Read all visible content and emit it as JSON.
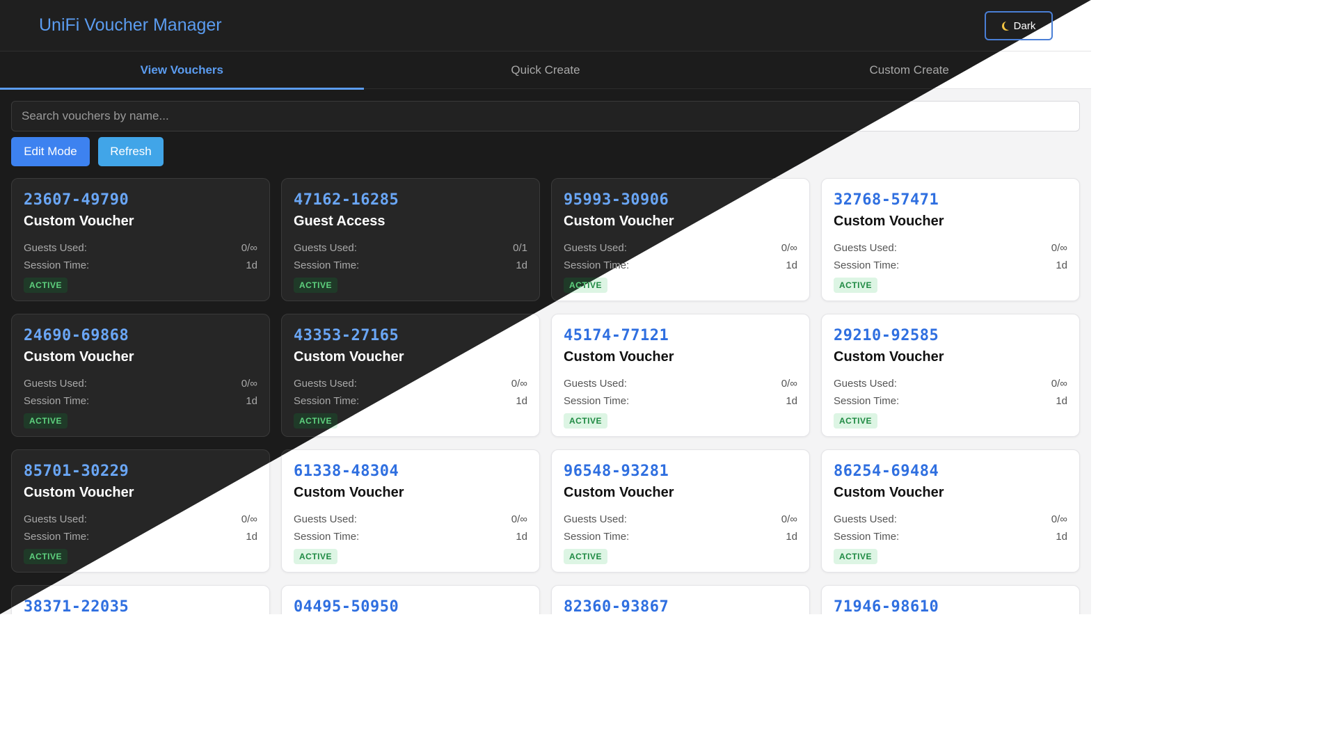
{
  "header": {
    "title": "UniFi Voucher Manager",
    "theme_toggle_label": "Dark"
  },
  "tabs": [
    {
      "label": "View Vouchers",
      "active": true
    },
    {
      "label": "Quick Create",
      "active": false
    },
    {
      "label": "Custom Create",
      "active": false
    }
  ],
  "search": {
    "placeholder": "Search vouchers by name...",
    "value": ""
  },
  "actions": {
    "edit_label": "Edit Mode",
    "refresh_label": "Refresh"
  },
  "labels": {
    "guests_used": "Guests Used:",
    "session_time": "Session Time:"
  },
  "colors": {
    "accent": "#5b9cf0",
    "edit_button": "#3d82f0",
    "refresh_button": "#41a5e8",
    "active_badge": "#1f8a43"
  },
  "vouchers": [
    {
      "code": "23607-49790",
      "name": "Custom Voucher",
      "guests": "0/∞",
      "session": "1d",
      "status": "ACTIVE"
    },
    {
      "code": "47162-16285",
      "name": "Guest Access",
      "guests": "0/1",
      "session": "1d",
      "status": "ACTIVE"
    },
    {
      "code": "95993-30906",
      "name": "Custom Voucher",
      "guests": "0/∞",
      "session": "1d",
      "status": "ACTIVE"
    },
    {
      "code": "32768-57471",
      "name": "Custom Voucher",
      "guests": "0/∞",
      "session": "1d",
      "status": "ACTIVE"
    },
    {
      "code": "24690-69868",
      "name": "Custom Voucher",
      "guests": "0/∞",
      "session": "1d",
      "status": "ACTIVE"
    },
    {
      "code": "43353-27165",
      "name": "Custom Voucher",
      "guests": "0/∞",
      "session": "1d",
      "status": "ACTIVE"
    },
    {
      "code": "45174-77121",
      "name": "Custom Voucher",
      "guests": "0/∞",
      "session": "1d",
      "status": "ACTIVE"
    },
    {
      "code": "29210-92585",
      "name": "Custom Voucher",
      "guests": "0/∞",
      "session": "1d",
      "status": "ACTIVE"
    },
    {
      "code": "85701-30229",
      "name": "Custom Voucher",
      "guests": "0/∞",
      "session": "1d",
      "status": "ACTIVE"
    },
    {
      "code": "61338-48304",
      "name": "Custom Voucher",
      "guests": "0/∞",
      "session": "1d",
      "status": "ACTIVE"
    },
    {
      "code": "96548-93281",
      "name": "Custom Voucher",
      "guests": "0/∞",
      "session": "1d",
      "status": "ACTIVE"
    },
    {
      "code": "86254-69484",
      "name": "Custom Voucher",
      "guests": "0/∞",
      "session": "1d",
      "status": "ACTIVE"
    },
    {
      "code": "38371-22035"
    },
    {
      "code": "04495-50950"
    },
    {
      "code": "82360-93867"
    },
    {
      "code": "71946-98610"
    }
  ]
}
